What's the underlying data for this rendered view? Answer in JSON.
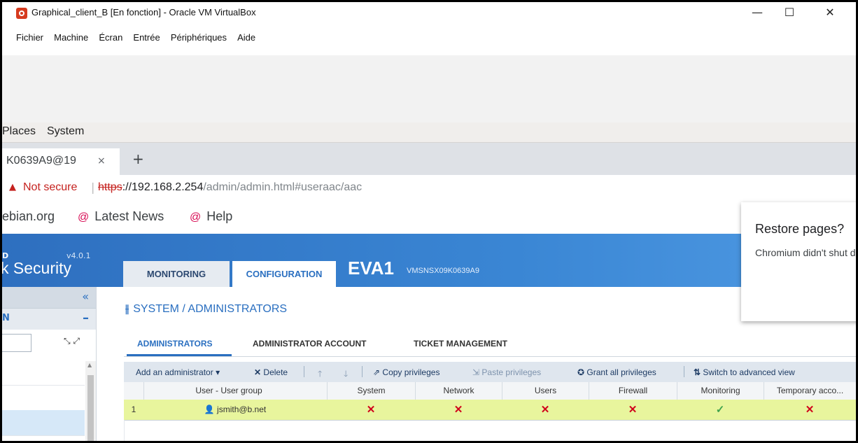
{
  "vbox": {
    "title": "Graphical_client_B [En fonction] - Oracle VM VirtualBox",
    "controls": {
      "minimize": "—",
      "maximize": "☐",
      "close": "✕"
    },
    "menu": [
      "Fichier",
      "Machine",
      "Écran",
      "Entrée",
      "Périphériques",
      "Aide"
    ]
  },
  "desktop": {
    "panel": [
      "Places",
      "System"
    ]
  },
  "browser": {
    "tab_title": "K0639A9@19",
    "tab_close": "×",
    "new_tab": "+",
    "not_secure": "Not secure",
    "url_scheme": "https",
    "url_host": "://192.168.2.254",
    "url_path": "/admin/admin.html#useraac/aac",
    "bookmarks": [
      "ebian.org",
      "Latest News",
      "Help"
    ]
  },
  "app": {
    "brand_top": "D",
    "version": "v4.0.1",
    "brand": "k Security",
    "tabs": {
      "monitoring": "MONITORING",
      "configuration": "CONFIGURATION"
    },
    "firewall_name": "EVA1",
    "serial": "VMSNSX09K0639A9",
    "sidebar": {
      "collapse": "«",
      "section_label": "N",
      "section_toggle": "–"
    },
    "page_title": "SYSTEM / ADMINISTRATORS",
    "subtabs": [
      "ADMINISTRATORS",
      "ADMINISTRATOR ACCOUNT",
      "TICKET MANAGEMENT"
    ],
    "toolbar": {
      "add": "Add an administrator",
      "delete": "Delete",
      "copy": "Copy privileges",
      "paste": "Paste privileges",
      "grant": "Grant all privileges",
      "switch": "Switch to advanced view"
    },
    "columns": [
      "User - User group",
      "System",
      "Network",
      "Users",
      "Firewall",
      "Monitoring",
      "Temporary acco..."
    ],
    "rows": [
      {
        "index": "1",
        "user": "jsmith@b.net",
        "system": "✕",
        "network": "✕",
        "users": "✕",
        "firewall": "✕",
        "monitoring": "✓",
        "temporary": "✕"
      }
    ]
  },
  "restore_popup": {
    "title": "Restore pages?",
    "body": "Chromium didn't shut down correctly."
  }
}
